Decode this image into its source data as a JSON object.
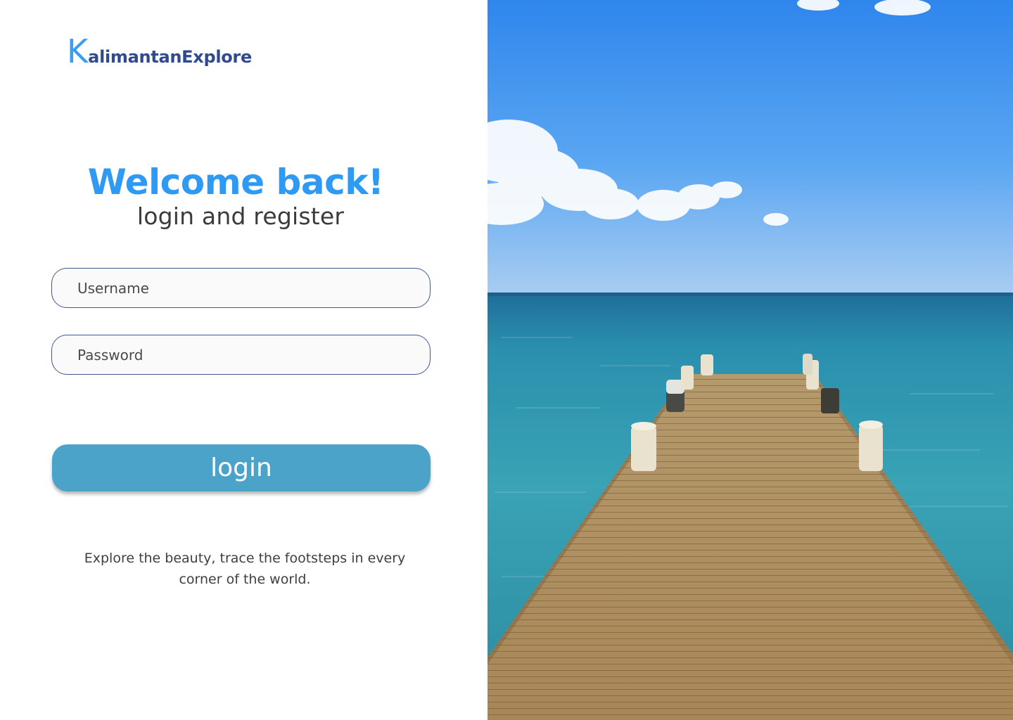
{
  "brand": {
    "logo_initial": "K",
    "logo_rest": "alimantanExplore"
  },
  "hero": {
    "title": "Welcome back!",
    "subtitle": "login and register"
  },
  "form": {
    "username_placeholder": "Username",
    "password_placeholder": "Password",
    "login_label": "login"
  },
  "tagline": "Explore the beauty, trace the footsteps in every corner of the world.",
  "photo": {
    "icon": "pier-ocean-photo"
  },
  "colors": {
    "accent_blue": "#2f9af3",
    "logo_navy": "#2f4a8f",
    "button": "#4ba3c9",
    "field_border": "#3c5b91"
  }
}
